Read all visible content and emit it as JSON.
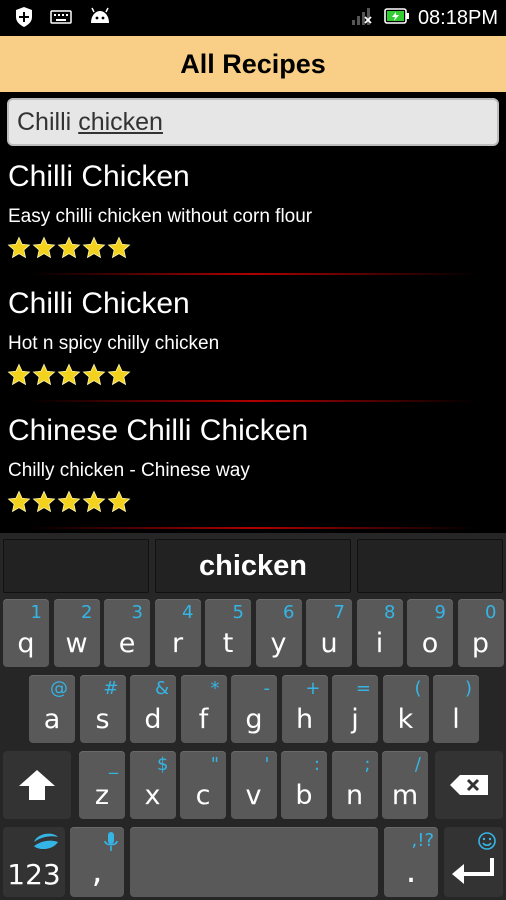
{
  "status_bar": {
    "time": "08:18PM"
  },
  "action_bar": {
    "title": "All Recipes"
  },
  "search": {
    "typed": "Chilli",
    "composing": "chicken"
  },
  "recipes": [
    {
      "title": "Chilli Chicken",
      "description": "Easy chilli chicken without corn flour",
      "rating": 5
    },
    {
      "title": "Chilli Chicken",
      "description": "Hot n spicy chilly chicken",
      "rating": 5
    },
    {
      "title": "Chinese Chilli Chicken",
      "description": "Chilly chicken - Chinese way",
      "rating": 5
    }
  ],
  "keyboard": {
    "suggestions": [
      "",
      "chicken",
      ""
    ],
    "row1": [
      {
        "key": "q",
        "hint": "1"
      },
      {
        "key": "w",
        "hint": "2"
      },
      {
        "key": "e",
        "hint": "3"
      },
      {
        "key": "r",
        "hint": "4"
      },
      {
        "key": "t",
        "hint": "5"
      },
      {
        "key": "y",
        "hint": "6"
      },
      {
        "key": "u",
        "hint": "7"
      },
      {
        "key": "i",
        "hint": "8"
      },
      {
        "key": "o",
        "hint": "9"
      },
      {
        "key": "p",
        "hint": "0"
      }
    ],
    "row2": [
      {
        "key": "a",
        "hint": "@"
      },
      {
        "key": "s",
        "hint": "#"
      },
      {
        "key": "d",
        "hint": "&"
      },
      {
        "key": "f",
        "hint": "*"
      },
      {
        "key": "g",
        "hint": "-"
      },
      {
        "key": "h",
        "hint": "+"
      },
      {
        "key": "j",
        "hint": "="
      },
      {
        "key": "k",
        "hint": "("
      },
      {
        "key": "l",
        "hint": ")"
      }
    ],
    "row3": [
      {
        "key": "z",
        "hint": "_"
      },
      {
        "key": "x",
        "hint": "$"
      },
      {
        "key": "c",
        "hint": "\""
      },
      {
        "key": "v",
        "hint": "'"
      },
      {
        "key": "b",
        "hint": ":"
      },
      {
        "key": "n",
        "hint": ";"
      },
      {
        "key": "m",
        "hint": "/"
      }
    ],
    "symbols_label": "123",
    "comma_label": ",",
    "period_label": ".",
    "period_hint": ",!?",
    "accent_color": "#35b5e5"
  }
}
